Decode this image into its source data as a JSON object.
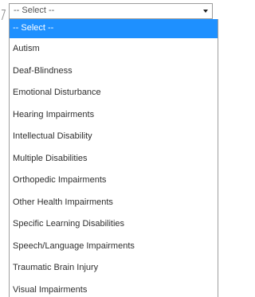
{
  "select": {
    "value": "-- Select --"
  },
  "dropdown": {
    "options": [
      "-- Select --",
      "Autism",
      "Deaf-Blindness",
      "Emotional Disturbance",
      "Hearing Impairments",
      "Intellectual Disability",
      "Multiple Disabilities",
      "Orthopedic Impairments",
      "Other Health Impairments",
      "Specific Learning Disabilities",
      "Speech/Language Impairments",
      "Traumatic Brain Injury",
      "Visual Impairments"
    ],
    "selected_index": 0
  },
  "colors": {
    "selected_background": "#1e90ff",
    "selected_text": "#ffffff",
    "option_text": "#2f2f2f",
    "border": "#9b9b9b"
  }
}
